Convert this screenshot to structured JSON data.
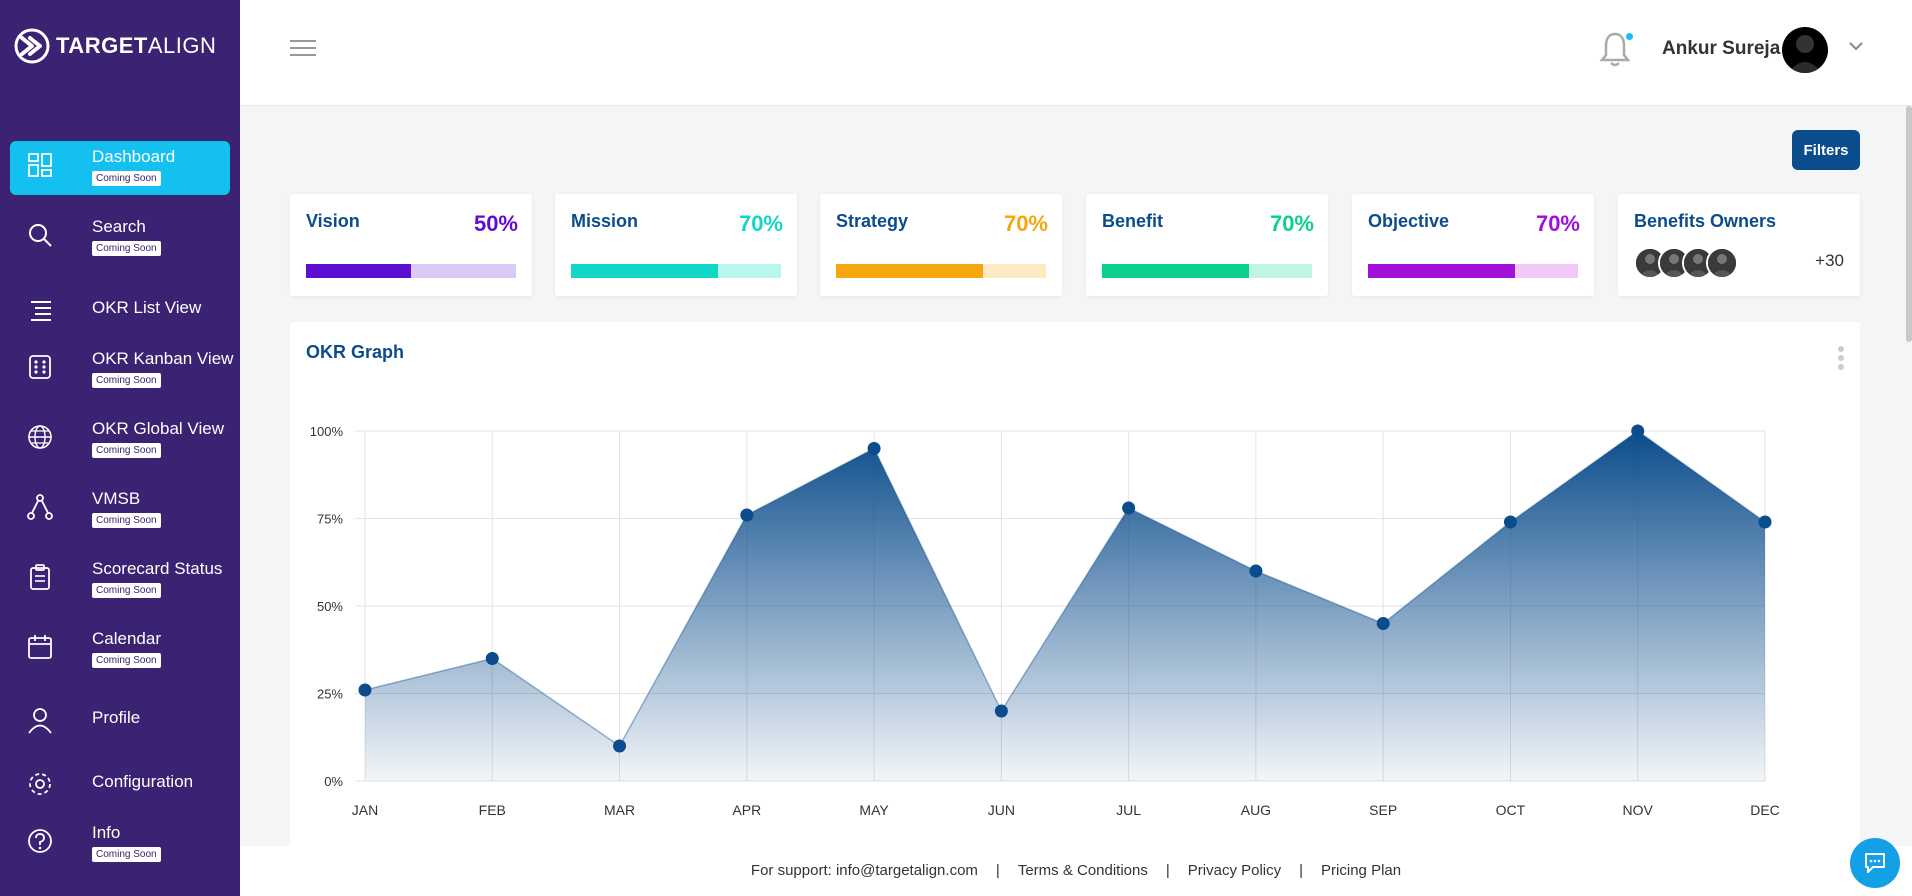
{
  "app": {
    "logo_text_bold": "TARGET",
    "logo_text_thin": "ALIGN"
  },
  "sidebar": {
    "items": [
      {
        "label": "Dashboard",
        "badge": "Coming Soon",
        "icon": "dashboard-icon",
        "active": true
      },
      {
        "label": "Search",
        "badge": "Coming Soon",
        "icon": "search-icon"
      },
      {
        "label": "OKR List View",
        "badge": "",
        "icon": "list-icon"
      },
      {
        "label": "OKR Kanban View",
        "badge": "Coming Soon",
        "icon": "kanban-icon"
      },
      {
        "label": "OKR Global View",
        "badge": "Coming Soon",
        "icon": "globe-icon"
      },
      {
        "label": "VMSB",
        "badge": "Coming Soon",
        "icon": "network-icon"
      },
      {
        "label": "Scorecard Status",
        "badge": "Coming Soon",
        "icon": "clipboard-icon"
      },
      {
        "label": "Calendar",
        "badge": "Coming Soon",
        "icon": "calendar-icon"
      },
      {
        "label": "Profile",
        "badge": "",
        "icon": "user-icon"
      },
      {
        "label": "Configuration",
        "badge": "",
        "icon": "gear-icon"
      },
      {
        "label": "Info",
        "badge": "Coming Soon",
        "icon": "help-icon"
      }
    ]
  },
  "header": {
    "user_name": "Ankur Sureja"
  },
  "toolbar": {
    "filters_label": "Filters"
  },
  "cards": [
    {
      "title": "Vision",
      "percent_label": "50%",
      "progress": 0.5,
      "color": "#5c0fd0",
      "track": "#dccaf6"
    },
    {
      "title": "Mission",
      "percent_label": "70%",
      "progress": 0.7,
      "color": "#12d6c6",
      "track": "#b9f6f0"
    },
    {
      "title": "Strategy",
      "percent_label": "70%",
      "progress": 0.7,
      "color": "#f6a60f",
      "track": "#fde9c2"
    },
    {
      "title": "Benefit",
      "percent_label": "70%",
      "progress": 0.7,
      "color": "#0bcf8a",
      "track": "#bff5e2"
    },
    {
      "title": "Objective",
      "percent_label": "70%",
      "progress": 0.7,
      "color": "#a20fd6",
      "track": "#f2c8f8"
    }
  ],
  "owners_card": {
    "title": "Benefits Owners",
    "count_label": "+30",
    "avatar_count": 4
  },
  "graph": {
    "title": "OKR Graph"
  },
  "chart_data": {
    "type": "area",
    "categories": [
      "JAN",
      "FEB",
      "MAR",
      "APR",
      "MAY",
      "JUN",
      "JUL",
      "AUG",
      "SEP",
      "OCT",
      "NOV",
      "DEC"
    ],
    "values": [
      26,
      35,
      10,
      76,
      95,
      20,
      78,
      60,
      45,
      74,
      100,
      74
    ],
    "y_ticks": [
      "0%",
      "25%",
      "50%",
      "75%",
      "100%"
    ],
    "ylim": [
      0,
      100
    ],
    "grid": true,
    "color": "#0b4c8c"
  },
  "footer": {
    "support": "For support: info@targetalign.com",
    "terms": "Terms & Conditions",
    "privacy": "Privacy Policy",
    "pricing": "Pricing Plan"
  }
}
